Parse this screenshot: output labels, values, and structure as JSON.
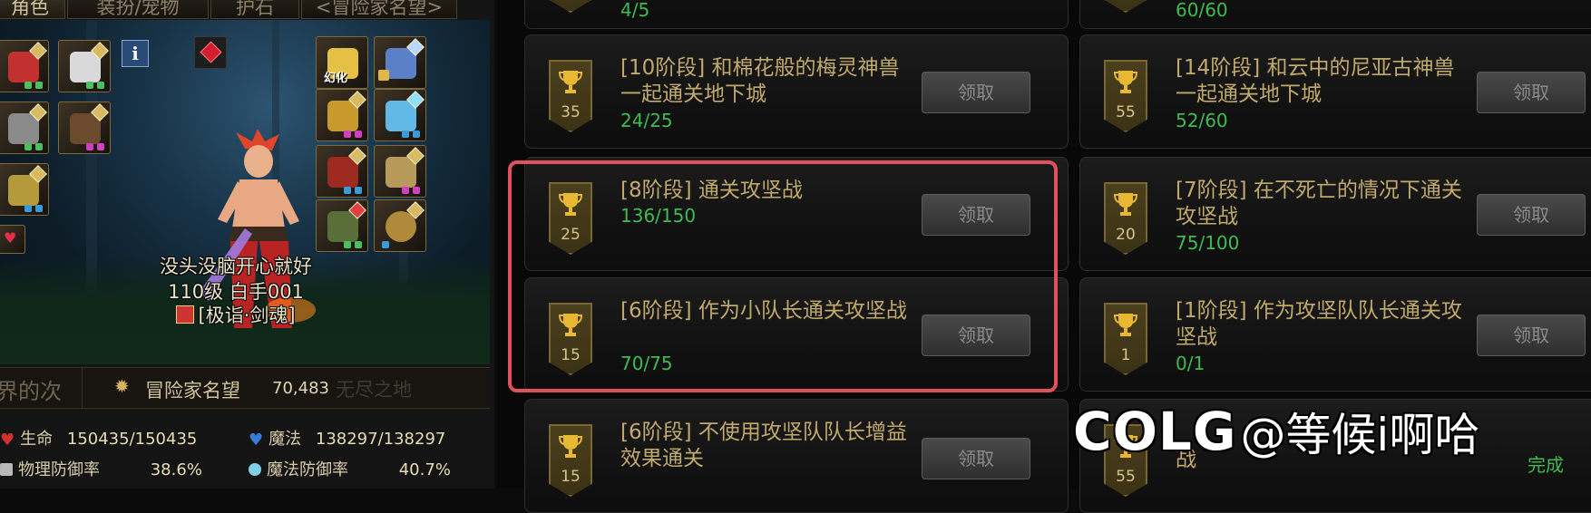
{
  "character_panel": {
    "tabs": [
      "角色",
      "装扮/宠物",
      "护石",
      "<冒险家名望>"
    ],
    "info_icon_label": "i",
    "transform_label": "幻化",
    "character": {
      "name": "没头没脑开心就好",
      "level_class": "110级 白手001",
      "title": "[极诣·剑魂]"
    },
    "reputation": {
      "left_fragment": "界的次",
      "label": "冒险家名望",
      "value": "70,483",
      "right_fragment": "无尽之地"
    },
    "stats": [
      {
        "label": "生命",
        "value": "150435/150435",
        "icon": "heart-icon",
        "color": "#d83030"
      },
      {
        "label": "魔法",
        "value": "138297/138297",
        "icon": "mana-heart-icon",
        "color": "#3a7ad8"
      },
      {
        "label": "物理防御率",
        "value": "38.6%",
        "icon": "physical-defense-icon",
        "color": "#b9b9b9"
      },
      {
        "label": "魔法防御率",
        "value": "40.7%",
        "icon": "magic-defense-icon",
        "color": "#7fd0e6"
      }
    ]
  },
  "quests": {
    "claim_label": "领取",
    "left_column": [
      {
        "title": "",
        "progress": "4/5",
        "points": ""
      },
      {
        "title": "[10阶段] 和棉花般的梅灵神兽一起通关地下城",
        "progress": "24/25",
        "points": "35"
      },
      {
        "title": "[8阶段] 通关攻坚战",
        "progress": "136/150",
        "points": "25"
      },
      {
        "title": "[6阶段] 作为小队长通关攻坚战",
        "progress": "70/75",
        "points": "15"
      },
      {
        "title": "[6阶段] 不使用攻坚队队长增益效果通关",
        "progress": "",
        "points": "15"
      }
    ],
    "right_column": [
      {
        "title": "",
        "progress": "60/60",
        "points": ""
      },
      {
        "title": "[14阶段] 和云中的尼亚古神兽一起通关地下城",
        "progress": "52/60",
        "points": "55"
      },
      {
        "title": "[7阶段] 在不死亡的情况下通关攻坚战",
        "progress": "75/100",
        "points": "20"
      },
      {
        "title": "[1阶段] 作为攻坚队队长通关攻坚战",
        "progress": "0/1",
        "points": "1"
      },
      {
        "title": "战",
        "progress": "",
        "points": "55",
        "status": "完成"
      }
    ]
  },
  "watermark": {
    "logo": "COLG",
    "handle": "@等候i啊哈"
  },
  "colors": {
    "highlight": "#e2505e",
    "progress_green": "#3cbc50",
    "title_gold": "#c0a96a"
  }
}
